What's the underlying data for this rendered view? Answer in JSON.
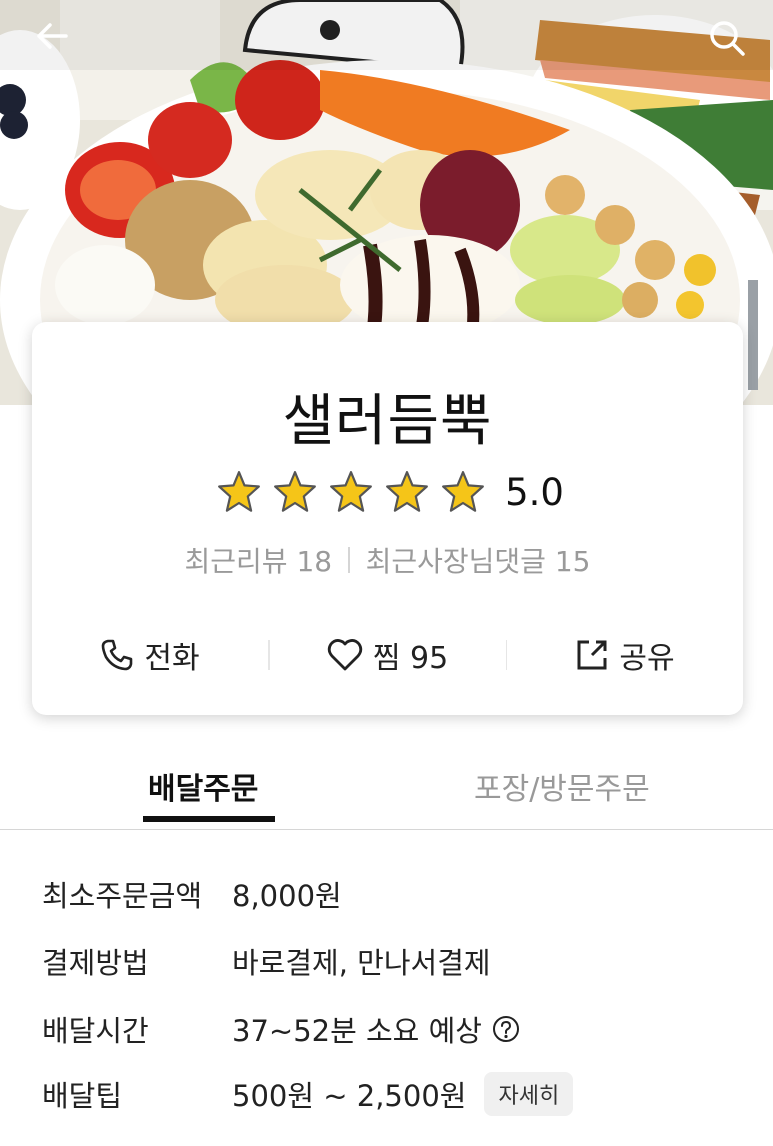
{
  "header": {
    "back_icon": "arrow-left-icon",
    "search_icon": "search-icon"
  },
  "shop": {
    "name": "샐러듬뿍",
    "stars": 5,
    "rating": "5.0",
    "recent_reviews": "최근리뷰 18",
    "owner_replies": "최근사장님댓글 15"
  },
  "actions": {
    "call_label": "전화",
    "like_label": "찜 95",
    "share_label": "공유"
  },
  "tabs": {
    "delivery_label": "배달주문",
    "pickup_label": "포장/방문주문"
  },
  "info": {
    "min_order_label": "최소주문금액",
    "min_order_value": "8,000원",
    "payment_label": "결제방법",
    "payment_value": "바로결제, 만나서결제",
    "time_label": "배달시간",
    "time_value": "37~52분 소요 예상",
    "tip_label": "배달팁",
    "tip_value": "500원 ~ 2,500원",
    "detail_button": "자세히"
  },
  "colors": {
    "star_fill": "#f5c518",
    "star_stroke": "#555555",
    "accent_text": "#111111"
  }
}
